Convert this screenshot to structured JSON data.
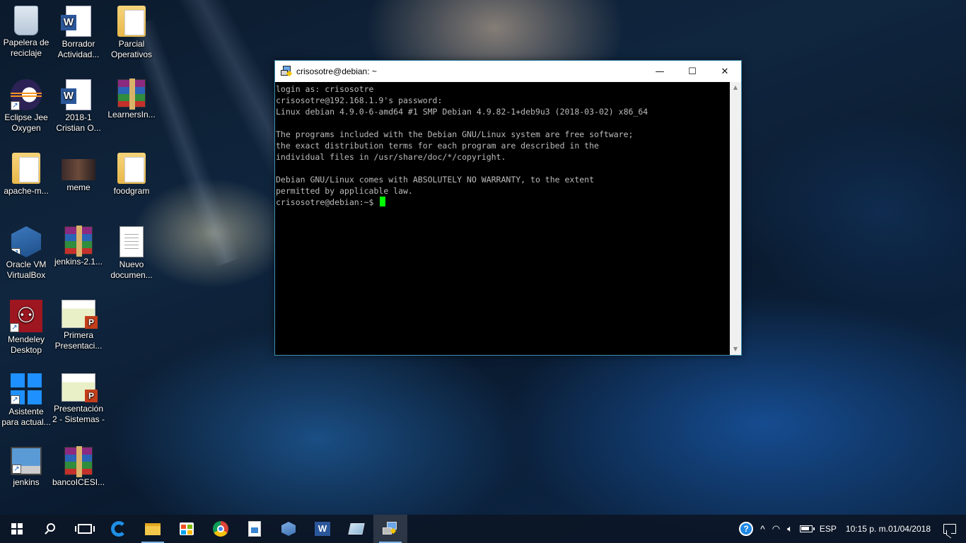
{
  "desktop": {
    "icons": [
      {
        "label": "Papelera de\nreciclaje",
        "icon": "recycle-bin-icon"
      },
      {
        "label": "Borrador\nActividad...",
        "icon": "word-document-icon"
      },
      {
        "label": "Parcial\nOperativos",
        "icon": "folder-icon"
      },
      {
        "label": "Eclipse Jee\nOxygen",
        "icon": "eclipse-icon"
      },
      {
        "label": "2018-1\nCristian O...",
        "icon": "word-document-icon"
      },
      {
        "label": "LearnersIn...",
        "icon": "winrar-archive-icon"
      },
      {
        "label": "apache-m...",
        "icon": "folder-icon"
      },
      {
        "label": "meme",
        "icon": "image-thumbnail-icon"
      },
      {
        "label": "foodgram",
        "icon": "folder-icon"
      },
      {
        "label": "Oracle VM\nVirtualBox",
        "icon": "virtualbox-icon"
      },
      {
        "label": "jenkins-2.1...",
        "icon": "winrar-archive-icon"
      },
      {
        "label": "Nuevo\ndocumen...",
        "icon": "text-document-icon"
      },
      {
        "label": "Mendeley\nDesktop",
        "icon": "mendeley-icon"
      },
      {
        "label": "Primera\nPresentaci...",
        "icon": "powerpoint-icon"
      },
      {
        "label": "Asistente\npara actual...",
        "icon": "windows-logo-icon"
      },
      {
        "label": "Presentación\n2 - Sistemas -",
        "icon": "powerpoint-icon"
      },
      {
        "label": "jenkins",
        "icon": "jenkins-icon"
      },
      {
        "label": "bancoICESI...",
        "icon": "winrar-archive-icon"
      }
    ]
  },
  "window": {
    "title": "crisosotre@debian: ~",
    "minimize_glyph": "—",
    "maximize_glyph": "☐",
    "close_glyph": "✕",
    "terminal_lines": [
      "login as: crisosotre",
      "crisosotre@192.168.1.9's password:",
      "Linux debian 4.9.0-6-amd64 #1 SMP Debian 4.9.82-1+deb9u3 (2018-03-02) x86_64",
      "",
      "The programs included with the Debian GNU/Linux system are free software;",
      "the exact distribution terms for each program are described in the",
      "individual files in /usr/share/doc/*/copyright.",
      "",
      "Debian GNU/Linux comes with ABSOLUTELY NO WARRANTY, to the extent",
      "permitted by applicable law."
    ],
    "prompt": "crisosotre@debian:~$ ",
    "cursor_color": "#00ff00",
    "text_color": "#bbbbbb"
  },
  "taskbar": {
    "apps": [
      "start-icon",
      "search-icon",
      "task-view-icon",
      "edge-icon",
      "file-explorer-icon",
      "store-icon",
      "chrome-icon",
      "photos-icon",
      "virtualbox-icon",
      "word-icon",
      "sticky-notes-icon",
      "putty-icon"
    ],
    "tray": {
      "help_glyph": "?",
      "chevron": "^",
      "language": "ESP",
      "time": "10:15 p. m.",
      "date": "01/04/2018"
    }
  }
}
